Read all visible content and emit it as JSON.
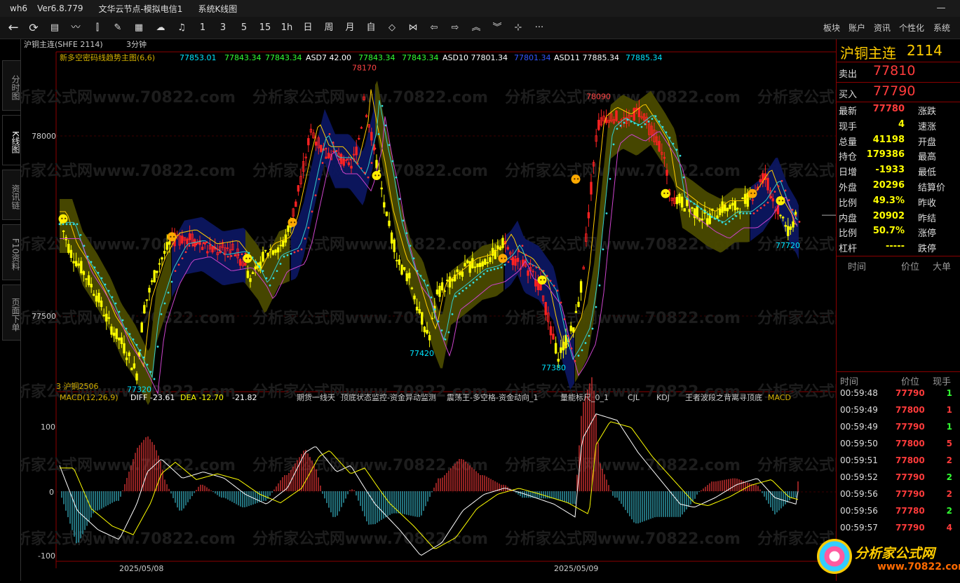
{
  "app": {
    "name": "wh6",
    "version": "Ver6.8.779",
    "node": "文华云节点-模拟电信1",
    "module": "系统K线图"
  },
  "toolbar": {
    "periods": [
      "1",
      "3",
      "5",
      "15",
      "1h",
      "日",
      "周",
      "月",
      "自"
    ],
    "right_menu": [
      "板块",
      "账户",
      "资讯",
      "个性化",
      "系统"
    ]
  },
  "side_tabs": [
    {
      "label": "分时图"
    },
    {
      "label": "K线图"
    },
    {
      "label": "资讯链"
    },
    {
      "label": "F10资料"
    },
    {
      "label": "页面下单"
    }
  ],
  "chart": {
    "symbol_label": "沪铜主连(SHFE 2114)",
    "period": "3分钟",
    "indicator_line": {
      "name": "新多空密码线趋势主图(6,6)",
      "v1": "77853.01",
      "v2": "77843.34",
      "v3": "77843.34",
      "asd7": "ASD7 42.00",
      "v4": "77843.34",
      "v5": "77843.34",
      "asd10": "ASD10 77801.34",
      "v6": "77801.34",
      "asd11": "ASD11 77885.34",
      "v7": "77885.34"
    },
    "price_axis": [
      {
        "label": "78000",
        "value": 78000
      },
      {
        "label": "77500",
        "value": 77500
      }
    ],
    "annotations": [
      {
        "text": "78170",
        "value": 78170
      },
      {
        "text": "78090",
        "value": 78090
      },
      {
        "text": "77320",
        "value": 77320
      },
      {
        "text": "77420",
        "value": 77420
      },
      {
        "text": "77380",
        "value": 77380
      },
      {
        "text": "77720",
        "value": 77720
      }
    ],
    "contract_note": "3 沪铜2506",
    "macd_line": {
      "name": "MACD(12,26,9)",
      "diff": "DIFF -23.61",
      "dea": "DEA -12.70",
      "macd": "-21.82"
    },
    "macd_tools": [
      "期货一线天",
      "顶底状态监控-资金异动监测",
      "震荡王-多空格-资金动向_1",
      "量能标尺_0_1",
      "CJL",
      "KDJ",
      "王者波段之背离寻顶底",
      "MACD"
    ],
    "macd_axis": [
      {
        "label": "100",
        "value": 100
      },
      {
        "label": "0",
        "value": 0
      },
      {
        "label": "-100",
        "value": -100
      }
    ],
    "dates": [
      "2025/05/08",
      "2025/05/09"
    ],
    "watermark": "分析家公式网www.70822.com"
  },
  "quote": {
    "title": "沪铜主连",
    "code": "2114",
    "sell": {
      "label": "卖出",
      "price": "77810"
    },
    "buy": {
      "label": "买入",
      "price": "77790"
    },
    "stats": [
      {
        "l": "最新",
        "v": "77780",
        "c": "#ff3b3b",
        "l2": "涨跌"
      },
      {
        "l": "现手",
        "v": "4",
        "c": "#ffff00",
        "l2": "速涨"
      },
      {
        "l": "总量",
        "v": "41198",
        "c": "#ffff00",
        "l2": "开盘"
      },
      {
        "l": "持仓",
        "v": "179386",
        "c": "#ffff00",
        "l2": "最高"
      },
      {
        "l": "日增",
        "v": "-1933",
        "c": "#ffff00",
        "l2": "最低"
      },
      {
        "l": "外盘",
        "v": "20296",
        "c": "#ffff00",
        "l2": "结算价"
      },
      {
        "l": "比例",
        "v": "49.3%",
        "c": "#ffff00",
        "l2": "昨收"
      },
      {
        "l": "内盘",
        "v": "20902",
        "c": "#ffff00",
        "l2": "昨结"
      },
      {
        "l": "比例",
        "v": "50.7%",
        "c": "#ffff00",
        "l2": "涨停"
      },
      {
        "l": "杠杆",
        "v": "-----",
        "c": "#ffff00",
        "l2": "跌停"
      }
    ],
    "trade_header": [
      "时间",
      "价位",
      "大单"
    ],
    "tick_header": [
      "时间",
      "价位",
      "现手"
    ],
    "ticks": [
      {
        "t": "00:59:48",
        "p": "77790",
        "v": "1",
        "vc": "#33ff33"
      },
      {
        "t": "00:59:49",
        "p": "77800",
        "v": "1",
        "vc": "#ff3b3b"
      },
      {
        "t": "00:59:49",
        "p": "77790",
        "v": "1",
        "vc": "#33ff33"
      },
      {
        "t": "00:59:50",
        "p": "77800",
        "v": "5",
        "vc": "#ff3b3b"
      },
      {
        "t": "00:59:51",
        "p": "77800",
        "v": "2",
        "vc": "#ff3b3b"
      },
      {
        "t": "00:59:52",
        "p": "77790",
        "v": "2",
        "vc": "#33ff33"
      },
      {
        "t": "00:59:56",
        "p": "77790",
        "v": "2",
        "vc": "#ff3b3b"
      },
      {
        "t": "00:59:56",
        "p": "77780",
        "v": "2",
        "vc": "#33ff33"
      },
      {
        "t": "00:59:57",
        "p": "77790",
        "v": "4",
        "vc": "#ff3b3b"
      }
    ],
    "logo_text": "分析家公式网",
    "logo_url": "www.70822.com"
  }
}
